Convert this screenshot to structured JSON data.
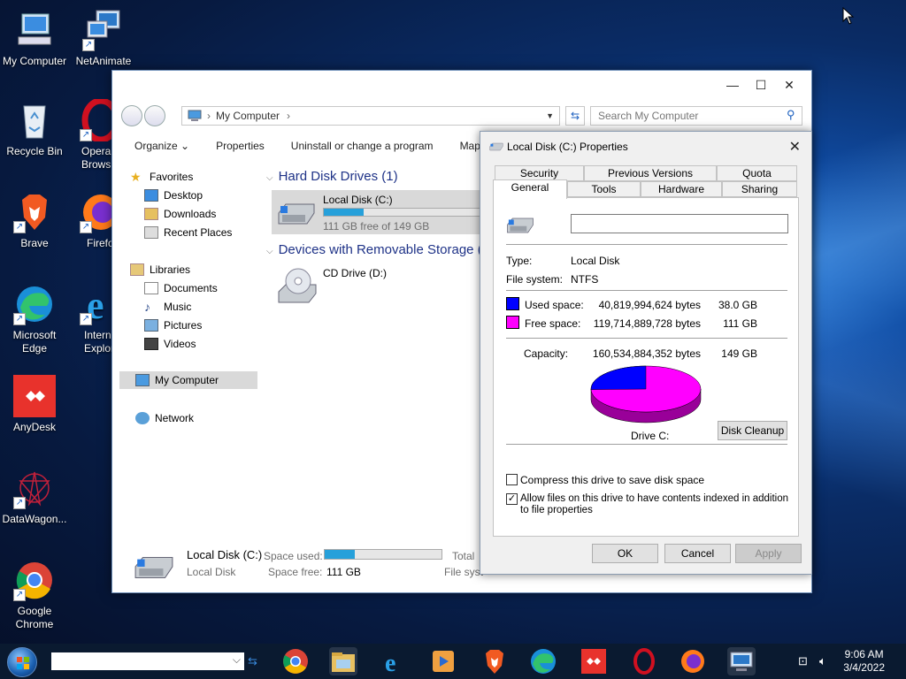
{
  "desktop": {
    "icons": [
      {
        "label": "My Computer"
      },
      {
        "label": "NetAnimate"
      },
      {
        "label": "Recycle Bin"
      },
      {
        "label": "Opera Brows"
      },
      {
        "label": "Brave"
      },
      {
        "label": "Firefo"
      },
      {
        "label": "Microsoft Edge"
      },
      {
        "label": "Intern Explor"
      },
      {
        "label": "AnyDesk"
      },
      {
        "label": "DataWagon..."
      },
      {
        "label": "Google Chrome"
      }
    ]
  },
  "explorer": {
    "controls": {
      "minimize": "—",
      "maximize": "☐",
      "close": "✕"
    },
    "address": {
      "path": "My Computer",
      "sep": "›"
    },
    "search": {
      "placeholder": "Search My Computer"
    },
    "toolbar": {
      "organize": "Organize ⌄",
      "properties": "Properties",
      "uninstall": "Uninstall or change a program",
      "map": "Map"
    },
    "nav": {
      "favorites": "Favorites",
      "desktop": "Desktop",
      "downloads": "Downloads",
      "recent": "Recent Places",
      "libraries": "Libraries",
      "documents": "Documents",
      "music": "Music",
      "pictures": "Pictures",
      "videos": "Videos",
      "mycomputer": "My Computer",
      "network": "Network"
    },
    "groups": {
      "hdd": "Hard Disk Drives (1)",
      "removable": "Devices with Removable Storage ("
    },
    "drives": {
      "c_name": "Local Disk (C:)",
      "c_free": "111 GB free of 149 GB",
      "c_used_fraction": 0.254,
      "d_name": "CD Drive (D:)"
    },
    "details": {
      "name": "Local Disk (C:)",
      "type": "Local Disk",
      "space_used_label": "Space used:",
      "space_free_label": "Space free:",
      "space_free_value": "111 GB",
      "total": "Total",
      "filesys": "File syst"
    }
  },
  "dialog": {
    "title": "Local Disk (C:) Properties",
    "close": "✕",
    "tabs_row1": [
      "Security",
      "Previous Versions",
      "Quota"
    ],
    "tabs_row2": [
      "General",
      "Tools",
      "Hardware",
      "Sharing"
    ],
    "name_value": "",
    "type_label": "Type:",
    "type_value": "Local Disk",
    "fs_label": "File system:",
    "fs_value": "NTFS",
    "used_label": "Used space:",
    "used_bytes": "40,819,994,624 bytes",
    "used_gb": "38.0 GB",
    "free_label": "Free space:",
    "free_bytes": "119,714,889,728 bytes",
    "free_gb": "111 GB",
    "cap_label": "Capacity:",
    "cap_bytes": "160,534,884,352 bytes",
    "cap_gb": "149 GB",
    "used_color": "#0000ff",
    "free_color": "#ff00ff",
    "drive_label": "Drive C:",
    "cleanup": "Disk Cleanup",
    "compress": "Compress this drive to save disk space",
    "compress_checked": false,
    "index": "Allow files on this drive to have contents indexed in addition to file properties",
    "index_checked": true,
    "ok": "OK",
    "cancel": "Cancel",
    "apply": "Apply"
  },
  "taskbar": {
    "time": "9:06 AM",
    "date": "3/4/2022"
  }
}
